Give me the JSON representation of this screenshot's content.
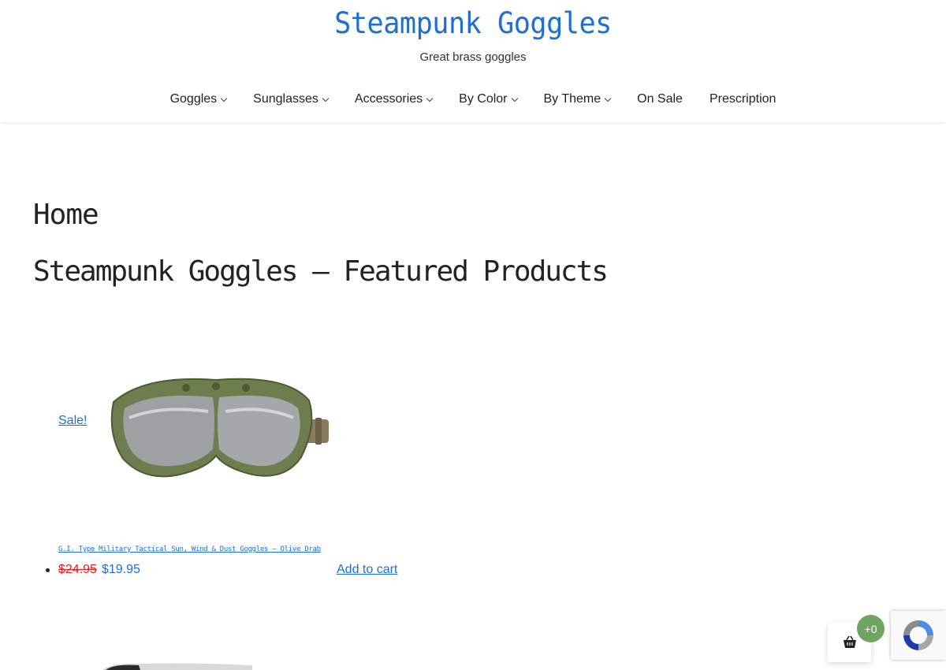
{
  "site": {
    "title": "Steampunk Goggles",
    "tagline": "Great brass goggles"
  },
  "nav": {
    "items": [
      {
        "label": "Goggles",
        "has_dropdown": true
      },
      {
        "label": "Sunglasses",
        "has_dropdown": true
      },
      {
        "label": "Accessories",
        "has_dropdown": true
      },
      {
        "label": "By Color",
        "has_dropdown": true
      },
      {
        "label": "By Theme",
        "has_dropdown": true
      },
      {
        "label": "On Sale",
        "has_dropdown": false
      },
      {
        "label": "Prescription",
        "has_dropdown": false
      }
    ]
  },
  "page": {
    "title": "Home",
    "section_title": "Steampunk Goggles – Featured Products"
  },
  "products": [
    {
      "sale_label": "Sale!",
      "name": "G.I. Type Military Tactical Sun, Wind & Dust Goggles – Olive Drab",
      "old_price": "$24.95",
      "new_price": "$19.95",
      "add_to_cart_label": "Add to cart"
    }
  ],
  "cart": {
    "count_label": "+0",
    "icon": "basket-icon"
  },
  "recaptcha": {
    "icon": "recaptcha-icon"
  },
  "colors": {
    "link": "#1b6fd6",
    "sale_price_old": "#d22222",
    "cart_badge": "#6fa463",
    "text": "#222222"
  }
}
